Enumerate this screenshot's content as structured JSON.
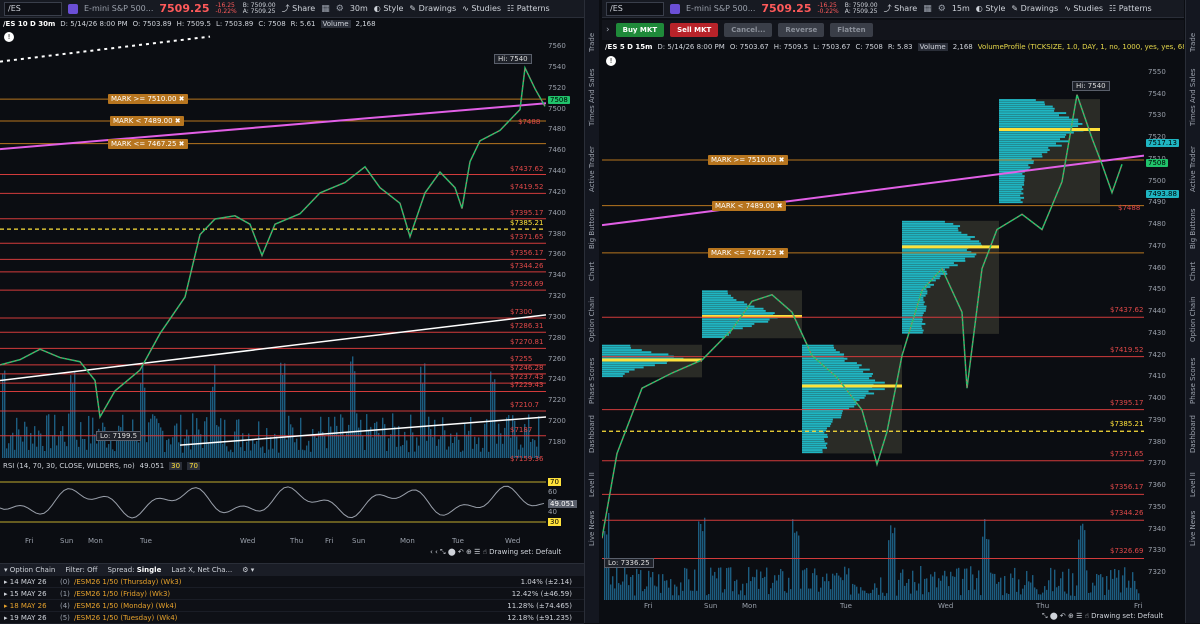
{
  "left": {
    "toolbar": {
      "symbol": "/ES",
      "name": "E-mini S&P 500...",
      "price": "7509.25",
      "change": "-16.25",
      "change_pct": "-0.22%",
      "bid": "B: 7509.00",
      "ask": "A: 7509.25",
      "share": "Share",
      "interval": "30m",
      "style": "Style",
      "drawings": "Drawings",
      "studies": "Studies",
      "patterns": "Patterns"
    },
    "info": {
      "head": "/ES 10 D 30m",
      "date": "D: 5/14/26 8:00 PM",
      "open": "O: 7503.89",
      "high": "H: 7509.5",
      "low": "L: 7503.89",
      "close": "C: 7508",
      "range": "R: 5.61",
      "volume_label": "Volume",
      "volume": "2,168"
    },
    "marks": [
      "MARK >= 7510.00 ✖",
      "MARK < 7489.00 ✖",
      "MARK <= 7467.25 ✖"
    ],
    "price_axis": [
      "7560",
      "7540",
      "7520",
      "7500",
      "7480",
      "7460",
      "7440",
      "7420",
      "7400",
      "7380",
      "7360",
      "7340",
      "7320",
      "7300",
      "7280",
      "7260",
      "7240",
      "7220",
      "7200",
      "7180"
    ],
    "levels": [
      "$7437.62",
      "$7419.52",
      "$7395.17",
      "$7371.65",
      "$7356.17",
      "$7344.26",
      "$7326.69",
      "$7300",
      "$7286.31",
      "$7270.81",
      "$7255",
      "$7246.28",
      "$7237.43",
      "$7229.43",
      "$7210.7",
      "$7187",
      "$7159.36"
    ],
    "yellow_level": "$7385.21",
    "last_price": "7508",
    "green_tag": "7508",
    "red_tag": "$7488",
    "hi": "Hi: 7540",
    "lo": "Lo: 7199.5",
    "rsi": {
      "label": "RSI (14, 70, 30, CLOSE, WILDERS, no)",
      "value": "49.051",
      "ob": "30",
      "os": "70",
      "axis": [
        "70",
        "60",
        "50",
        "40",
        "30"
      ]
    },
    "xaxis": [
      "Fri",
      "Sun",
      "Mon",
      "Tue",
      "Wed",
      "Thu",
      "Fri",
      "Sun",
      "Mon",
      "Tue",
      "Wed",
      "Thu"
    ],
    "drawing_set": "Drawing set: Default",
    "side_tabs": [
      "Trade",
      "Times And Sales",
      "Active Trader",
      "Big Buttons",
      "Chart",
      "Option Chain",
      "Phase Scores",
      "Dashboard",
      "Level II",
      "Live News"
    ]
  },
  "option_chain": {
    "title": "Option Chain",
    "filter": "Filter: Off",
    "spread": "Spread:",
    "spread_val": "Single",
    "layout": "Last X, Net Cha...",
    "rows": [
      {
        "date": "14 MAY 26",
        "count": "(0)",
        "name": "/ESM26 1/50 (Thursday) (Wk3)",
        "val": "1.04% (±2.14)"
      },
      {
        "date": "15 MAY 26",
        "count": "(1)",
        "name": "/ESM26 1/50 (Friday) (Wk3)",
        "val": "12.42% (±46.59)"
      },
      {
        "date": "18 MAY 26",
        "count": "(4)",
        "name": "/ESM26 1/50 (Monday) (Wk4)",
        "val": "11.28% (±74.465)"
      },
      {
        "date": "19 MAY 26",
        "count": "(5)",
        "name": "/ESM26 1/50 (Tuesday) (Wk4)",
        "val": "12.18% (±91.235)"
      }
    ]
  },
  "right": {
    "toolbar": {
      "symbol": "/ES",
      "name": "E-mini S&P 500...",
      "price": "7509.25",
      "change": "-16.25",
      "change_pct": "-0.22%",
      "bid": "B: 7509.00",
      "ask": "A: 7509.25",
      "share": "Share",
      "interval": "15m",
      "style": "Style",
      "drawings": "Drawings",
      "studies": "Studies",
      "patterns": "Patterns"
    },
    "buttons": {
      "buy": "Buy MKT",
      "sell": "Sell MKT",
      "cancel": "Cancel...",
      "reverse": "Reverse",
      "flatten": "Flatten"
    },
    "info": {
      "head": "/ES 5 D 15m",
      "date": "D: 5/14/26 8:00 PM",
      "open": "O: 7503.67",
      "high": "H: 7509.5",
      "low": "L: 7503.67",
      "close": "C: 7508",
      "range": "R: 5.83",
      "volume_label": "Volume",
      "volume": "2,168",
      "profile": "VolumeProfile (TICKSIZE, 1.0, DAY, 1, no, 1000, yes, yes, 68, 50)"
    },
    "marks": [
      "MARK >= 7510.00 ✖",
      "MARK < 7489.00 ✖",
      "MARK <= 7467.25 ✖"
    ],
    "price_axis": [
      "7550",
      "7540",
      "7530",
      "7520",
      "7510",
      "7500",
      "7490",
      "7480",
      "7470",
      "7460",
      "7450",
      "7440",
      "7430",
      "7420",
      "7410",
      "7400",
      "7390",
      "7380",
      "7370",
      "7360",
      "7350",
      "7340",
      "7330",
      "7320"
    ],
    "levels": [
      "$7437.62",
      "$7419.52",
      "$7395.17",
      "$7371.65",
      "$7356.17",
      "$7344.26",
      "$7326.69"
    ],
    "yellow_level": "$7385.21",
    "tags": [
      "7517.13",
      "7508",
      "7493.88",
      "$7488"
    ],
    "hi": "Hi: 7540",
    "lo": "Lo: 7336.25",
    "xaxis": [
      "Fri",
      "Sun",
      "Mon",
      "Tue",
      "Wed",
      "Thu",
      "Fri"
    ],
    "drawing_set": "Drawing set: Default",
    "side_tabs": [
      "Trade",
      "Times And Sales",
      "Active Trader",
      "Big Buttons",
      "Chart",
      "Option Chain",
      "Phase Scores",
      "Dashboard",
      "Level II",
      "Live News"
    ]
  }
}
